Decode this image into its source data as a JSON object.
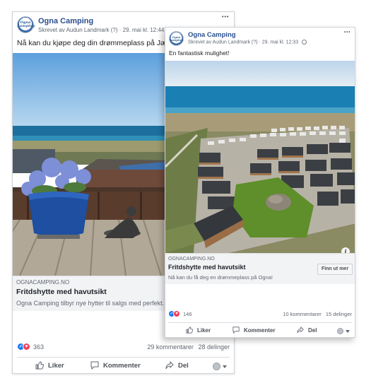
{
  "post_left": {
    "page_name": "Ogna Camping",
    "avatar_text": "Ogna camping",
    "author_line": "Skrevet av Audun Landmark",
    "author_info": "(?)",
    "dot": "·",
    "timestamp": "29. mai kl. 12:44",
    "more": "•••",
    "text": "Nå kan du kjøpe deg din drømmeplass på Jæren",
    "link": {
      "domain": "OGNACAMPING.NO",
      "title": "Fritdshytte med havutsikt",
      "description": "Ogna Camping tilbyr nye hytter til salgs med perfekt..."
    },
    "reactions_count": "363",
    "comments": "29 kommentarer",
    "shares": "28 delinger",
    "actions": {
      "like": "Liker",
      "comment": "Kommenter",
      "share": "Del"
    }
  },
  "post_right": {
    "page_name": "Ogna Camping",
    "avatar_text": "Ogna camping",
    "author_line": "Skrevet av Audun Landmark",
    "author_info": "(?)",
    "dot": "·",
    "timestamp": "29. mai kl. 12:33",
    "more": "•••",
    "text": "En fantastisk mulighet!",
    "info": "i",
    "link": {
      "domain": "OGNACAMPING.NO",
      "title": "Fritdshytte med havutsikt",
      "description": "Nå kan du få deg en drømmeplass på Ogna!",
      "cta": "Finn ut mer"
    },
    "reactions_count": "146",
    "comments": "10 kommentarer",
    "shares": "15 delinger",
    "actions": {
      "like": "Liker",
      "comment": "Kommenter",
      "share": "Del"
    }
  },
  "colors": {
    "like": "#1877f2",
    "love": "#f33e58",
    "page_name": "#2a4f8f"
  }
}
